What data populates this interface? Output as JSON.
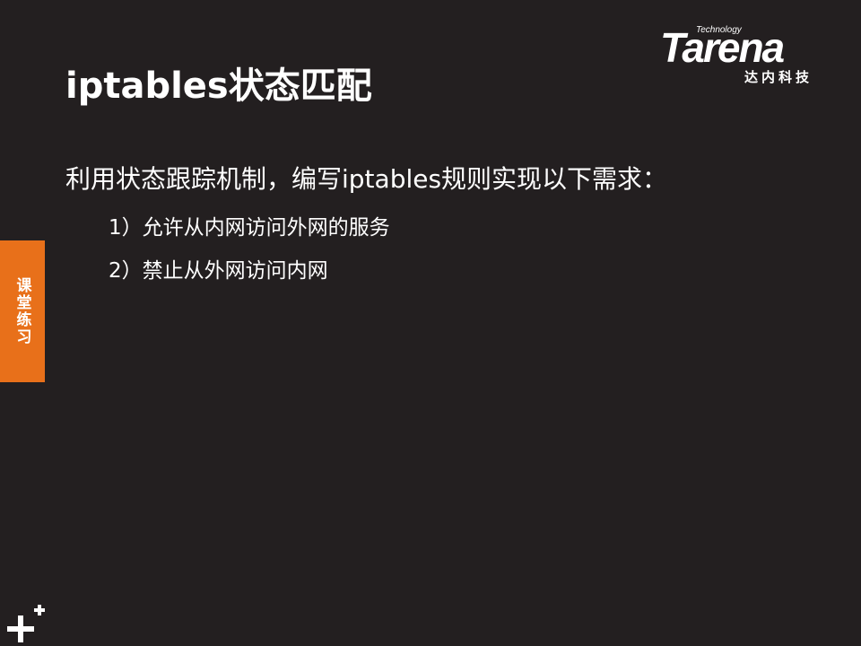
{
  "title": "iptables状态匹配",
  "logo": {
    "technology": "Technology",
    "brand": "Tarena",
    "subtitle": "达内科技"
  },
  "intro": "利用状态跟踪机制，编写iptables规则实现以下需求：",
  "requirements": [
    "1）允许从内网访问外网的服务",
    "2）禁止从外网访问内网"
  ],
  "side_tab": {
    "label": "课堂练习",
    "color": "#e8701a"
  },
  "colors": {
    "background": "#231f20",
    "text": "#ffffff",
    "accent": "#e8701a"
  },
  "icons": {
    "corner": "plus-plus-icon"
  }
}
